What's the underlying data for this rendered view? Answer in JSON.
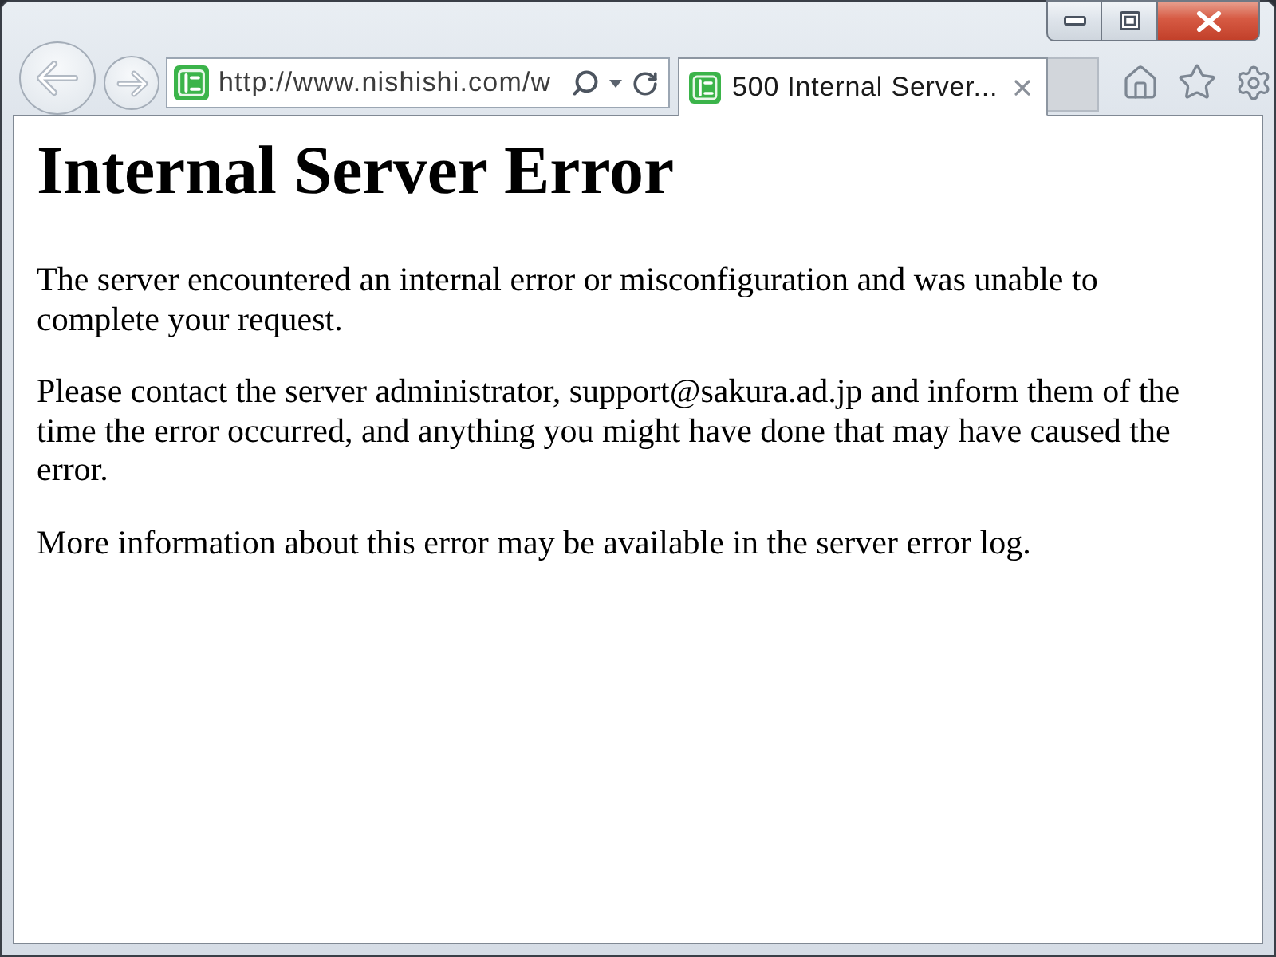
{
  "address_bar": {
    "value": "http://www.nishishi.com/w"
  },
  "tabs": [
    {
      "title": "500 Internal Server...",
      "selected": true
    }
  ],
  "page": {
    "heading": "Internal Server Error",
    "paragraphs": [
      "The server encountered an internal error or misconfiguration and was unable to complete your request.",
      "Please contact the server administrator, support@sakura.ad.jp and inform them of the time the error occurred, and anything you might have done that may have caused the error.",
      "More information about this error may be available in the server error log."
    ]
  }
}
